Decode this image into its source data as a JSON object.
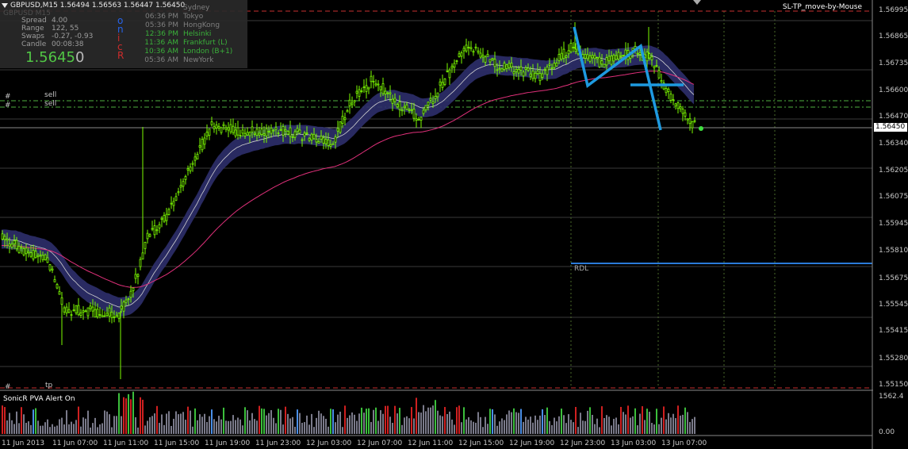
{
  "header": {
    "symbol_line": "GBPUSD,M15  1.56494 1.56563 1.56447 1.56450",
    "ghost": "GBPUSD    M15"
  },
  "info_panel": {
    "rows": [
      {
        "label": "Spread",
        "value": "4.00"
      },
      {
        "label": "Range",
        "value": "122, 55"
      },
      {
        "label": "Swaps",
        "value": "-0.27, -0.93"
      },
      {
        "label": "Candle",
        "value": "00:08:38"
      }
    ],
    "big_price_main": "1.5645",
    "big_price_last": "0",
    "letters": [
      {
        "text": "o",
        "color": "#2a6cff"
      },
      {
        "text": "n",
        "color": "#2a6cff"
      },
      {
        "text": "i",
        "color": "#e03030"
      },
      {
        "text": "c",
        "color": "#e03030"
      },
      {
        "text": "R",
        "color": "#e03030"
      }
    ],
    "sessions": [
      {
        "time": "",
        "city": "Sydney",
        "color": "#8a8a8a"
      },
      {
        "time": "06:36 PM",
        "city": "Tokyo",
        "color": "#8a8a8a"
      },
      {
        "time": "05:36 PM",
        "city": "HongKong",
        "color": "#8a8a8a"
      },
      {
        "time": "12:36 PM",
        "city": "Helsinki",
        "color": "#3fbf3f"
      },
      {
        "time": "11:36 AM",
        "city": "Frankfurt  (L)",
        "color": "#3fbf3f"
      },
      {
        "time": "10:36 AM",
        "city": "London  (B+1)",
        "color": "#3fbf3f"
      },
      {
        "time": "05:36 AM",
        "city": "NewYork",
        "color": "#8a8a8a"
      }
    ]
  },
  "ribbon_labels": [
    {
      "text": "#",
      "sub": "sell"
    },
    {
      "text": "#",
      "sub": "sell"
    },
    {
      "text": "#",
      "sub": "tp"
    }
  ],
  "sl_tp_label": "SL-TP_move-by-Mouse",
  "rdl_label": "RDL",
  "price_axis": {
    "labels": [
      "1.56995",
      "1.56865",
      "1.56735",
      "1.56600",
      "1.56470",
      "1.56340",
      "1.56205",
      "1.56075",
      "1.55945",
      "1.55810",
      "1.55675",
      "1.55545",
      "1.55415",
      "1.55280",
      "1.55150"
    ],
    "current": "1.56450"
  },
  "time_axis": {
    "labels": [
      "11 Jun 2013",
      "11 Jun 07:00",
      "11 Jun 11:00",
      "11 Jun 15:00",
      "11 Jun 19:00",
      "11 Jun 23:00",
      "12 Jun 03:00",
      "12 Jun 07:00",
      "12 Jun 11:00",
      "12 Jun 15:00",
      "12 Jun 19:00",
      "12 Jun 23:00",
      "13 Jun 03:00",
      "13 Jun 07:00"
    ]
  },
  "volume": {
    "title": "SonicR PVA   Alert On",
    "axis_top": "1562.4",
    "axis_bottom": "0.00"
  },
  "colors": {
    "candle": "#7cfc00",
    "band_fill": "#2e2f6b",
    "ema": "#d0d0d0",
    "ma_pink": "#e0307a",
    "pattern": "#1e9ae0",
    "red_dash": "#c83030",
    "green_dash": "#4faf3f",
    "vol_normal": "#7a7a8a",
    "vol_green": "#3cbf3c",
    "vol_red": "#d02020",
    "vol_blue": "#4a8fe8"
  }
}
